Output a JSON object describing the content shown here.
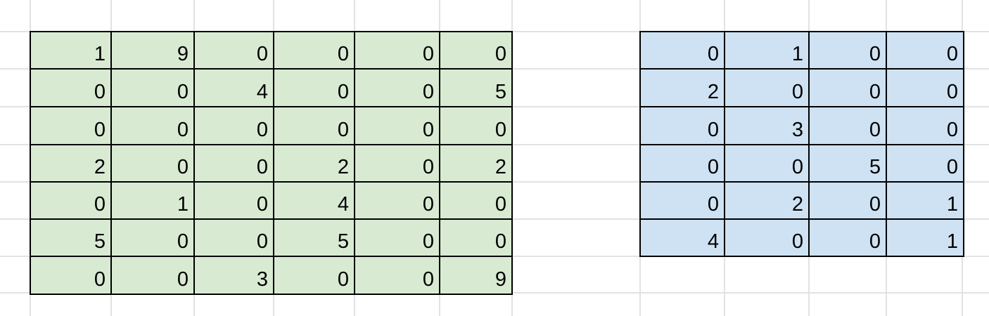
{
  "sheet": {
    "colors": {
      "left_fill": "#d9ead3",
      "right_fill": "#cfe2f3",
      "gridline": "#e2e2e2",
      "border": "#000000"
    },
    "left_block": [
      [
        "1",
        "9",
        "0",
        "0",
        "0",
        "0"
      ],
      [
        "0",
        "0",
        "4",
        "0",
        "0",
        "5"
      ],
      [
        "0",
        "0",
        "0",
        "0",
        "0",
        "0"
      ],
      [
        "2",
        "0",
        "0",
        "2",
        "0",
        "2"
      ],
      [
        "0",
        "1",
        "0",
        "4",
        "0",
        "0"
      ],
      [
        "5",
        "0",
        "0",
        "5",
        "0",
        "0"
      ],
      [
        "0",
        "0",
        "3",
        "0",
        "0",
        "9"
      ]
    ],
    "right_block": [
      [
        "0",
        "1",
        "0",
        "0"
      ],
      [
        "2",
        "0",
        "0",
        "0"
      ],
      [
        "0",
        "3",
        "0",
        "0"
      ],
      [
        "0",
        "0",
        "5",
        "0"
      ],
      [
        "0",
        "2",
        "0",
        "1"
      ],
      [
        "4",
        "0",
        "0",
        "1"
      ]
    ]
  }
}
